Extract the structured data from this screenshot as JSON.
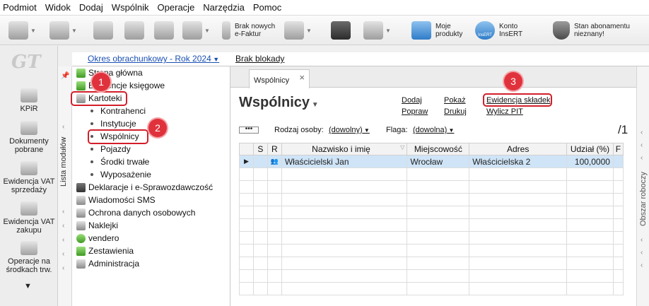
{
  "menu": [
    "Podmiot",
    "Widok",
    "Dodaj",
    "Wspólnik",
    "Operacje",
    "Narzędzia",
    "Pomoc"
  ],
  "toolbar": {
    "efaktur": "Brak nowych e-Faktur",
    "moje_produkty": "Moje produkty",
    "konto": "Konto InsERT",
    "konto_icon_text": "InsERT",
    "abonament": "Stan abonamentu nieznany!",
    "accent": "#2f7cc8"
  },
  "left_strip": {
    "logo": "GT",
    "items": [
      "KPiR",
      "Dokumenty pobrane",
      "Ewidencja VAT sprzedaży",
      "Ewidencja VAT zakupu",
      "Operacje na środkach trw."
    ],
    "more": "▼"
  },
  "period": {
    "label": "Okres obrachunkowy - Rok 2024",
    "block": "Brak blokady"
  },
  "modules": {
    "strip_label": "Lista modułów",
    "items": [
      {
        "label": "Strona główna",
        "icon": "home-icon"
      },
      {
        "label": "Ewidencje księgowe",
        "icon": "ledger-icon"
      },
      {
        "label": "Kartoteki",
        "icon": "cards-icon"
      },
      {
        "label": "Kontrahenci"
      },
      {
        "label": "Instytucje"
      },
      {
        "label": "Wspólnicy"
      },
      {
        "label": "Pojazdy"
      },
      {
        "label": "Środki trwałe"
      },
      {
        "label": "Wyposażenie"
      },
      {
        "label": "Deklaracje i e-Sprawozdawczość",
        "icon": "declaration-icon"
      },
      {
        "label": "Wiadomości SMS",
        "icon": "sms-icon"
      },
      {
        "label": "Ochrona danych osobowych",
        "icon": "shield-icon"
      },
      {
        "label": "Naklejki",
        "icon": "sticker-icon"
      },
      {
        "label": "vendero",
        "icon": "vendero-icon"
      },
      {
        "label": "Zestawienia",
        "icon": "report-icon"
      },
      {
        "label": "Administracja",
        "icon": "admin-icon"
      }
    ]
  },
  "badges": [
    "1",
    "2",
    "3"
  ],
  "highlight_color": "#d21f2a",
  "main": {
    "tab": "Wspólnicy",
    "title": "Wspólnicy",
    "actions": {
      "dodaj": "Dodaj",
      "popraw": "Popraw",
      "pokaz": "Pokaż",
      "drukuj": "Drukuj",
      "ewidencja": "Ewidencja składek",
      "pit": "Wylicz PIT"
    },
    "filters": {
      "rodzaj_label": "Rodzaj osoby:",
      "rodzaj_value": "(dowolny)",
      "flaga_label": "Flaga:",
      "flaga_value": "(dowolna)"
    },
    "page_count": "/1",
    "columns": [
      "S",
      "R",
      "Nazwisko i imię",
      "Miejscowość",
      "Adres",
      "Udział (%)",
      "F"
    ],
    "rows": [
      {
        "s": "",
        "r": "👥",
        "name": "Właścicielski Jan",
        "city": "Wrocław",
        "address": "Właścicielska 2",
        "share": "100,0000",
        "f": ""
      }
    ]
  },
  "right_strip": {
    "label": "Obszar roboczy"
  }
}
